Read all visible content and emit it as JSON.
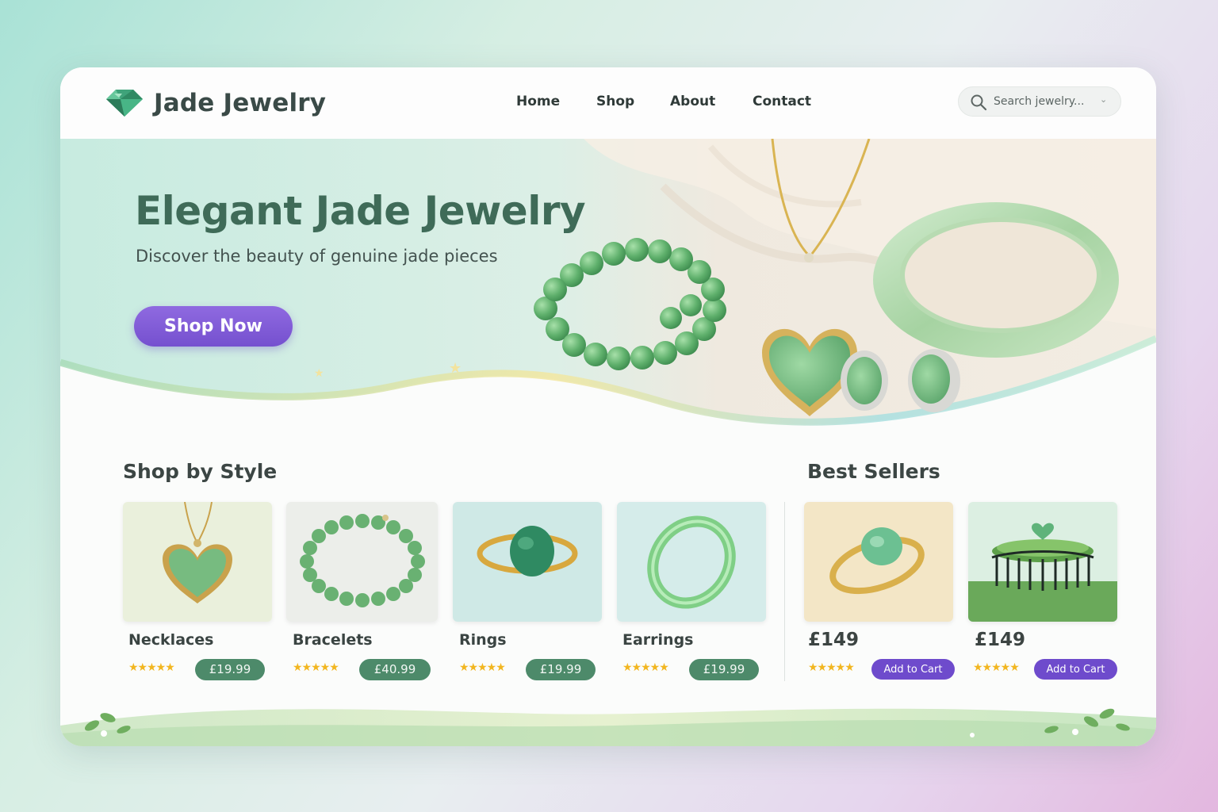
{
  "brand": {
    "name": "Jade Jewelry",
    "icon": "jade-gem-icon"
  },
  "nav": {
    "items": [
      {
        "label": "Home"
      },
      {
        "label": "Shop"
      },
      {
        "label": "About"
      },
      {
        "label": "Contact"
      }
    ]
  },
  "search": {
    "placeholder": "Search jewelry...",
    "icon": "search-icon"
  },
  "hero": {
    "title": "Elegant Jade Jewelry",
    "subtitle": "Discover the beauty of genuine jade pieces",
    "cta_label": "Shop Now"
  },
  "shop_by_style": {
    "title": "Shop by Style",
    "items": [
      {
        "label": "Necklaces",
        "stars": "★★★★★",
        "price": "£19.99"
      },
      {
        "label": "Bracelets",
        "stars": "★★★★★",
        "price": "£40.99"
      },
      {
        "label": "Rings",
        "stars": "★★★★★",
        "price": "£19.99"
      },
      {
        "label": "Earrings",
        "stars": "★★★★★",
        "price": "£19.99"
      }
    ]
  },
  "best_sellers": {
    "title": "Best Sellers",
    "items": [
      {
        "price": "£149",
        "stars": "★★★★★",
        "cta": "Add to Cart"
      },
      {
        "price": "£149",
        "stars": "★★★★★",
        "cta": "Add to Cart"
      }
    ]
  },
  "colors": {
    "jade_green": "#4d8a6a",
    "title_green": "#3f6b58",
    "accent_purple": "#7550cf",
    "star_gold": "#f2b620"
  }
}
